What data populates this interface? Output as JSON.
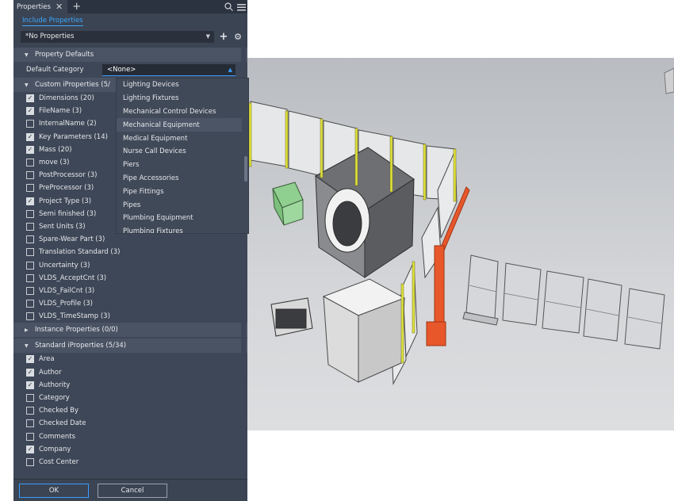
{
  "panel": {
    "tab_label": "Properties",
    "include_link": "Include Properties",
    "preset_value": "*No Properties"
  },
  "property_defaults": {
    "header": "Property Defaults",
    "default_category_label": "Default Category",
    "default_category_value": "<None>"
  },
  "dropdown_options": [
    "Lighting Devices",
    "Lighting Fixtures",
    "Mechanical Control Devices",
    "Mechanical Equipment",
    "Medical Equipment",
    "Nurse Call Devices",
    "Piers",
    "Pipe Accessories",
    "Pipe Fittings",
    "Pipes",
    "Plumbing Equipment",
    "Plumbing Fixtures"
  ],
  "custom": {
    "header": "Custom iProperties (5/",
    "items": [
      {
        "label": "Dimensions (20)",
        "checked": true
      },
      {
        "label": "FileName (3)",
        "checked": true
      },
      {
        "label": "InternalName (2)",
        "checked": false
      },
      {
        "label": "Key Parameters (14)",
        "checked": true
      },
      {
        "label": "Mass (20)",
        "checked": true
      },
      {
        "label": "move (3)",
        "checked": false
      },
      {
        "label": "PostProcessor (3)",
        "checked": false
      },
      {
        "label": "PreProcessor (3)",
        "checked": false
      },
      {
        "label": "Project Type (3)",
        "checked": true
      },
      {
        "label": "Semi finished (3)",
        "checked": false
      },
      {
        "label": "Sent Units (3)",
        "checked": false
      },
      {
        "label": "Spare-Wear Part (3)",
        "checked": false
      },
      {
        "label": "Translation Standard (3)",
        "checked": false
      },
      {
        "label": "Uncertainty (3)",
        "checked": false
      },
      {
        "label": "VLDS_AcceptCnt (3)",
        "checked": false
      },
      {
        "label": "VLDS_FailCnt (3)",
        "checked": false
      },
      {
        "label": "VLDS_Profile (3)",
        "checked": false
      },
      {
        "label": "VLDS_TimeStamp (3)",
        "checked": false
      }
    ]
  },
  "instance": {
    "header": "Instance Properties (0/0)"
  },
  "standard": {
    "header": "Standard iProperties (5/34)",
    "items": [
      {
        "label": "Area",
        "checked": true
      },
      {
        "label": "Author",
        "checked": true
      },
      {
        "label": "Authority",
        "checked": true
      },
      {
        "label": "Category",
        "checked": false
      },
      {
        "label": "Checked By",
        "checked": false
      },
      {
        "label": "Checked Date",
        "checked": false
      },
      {
        "label": "Comments",
        "checked": false
      },
      {
        "label": "Company",
        "checked": true
      },
      {
        "label": "Cost Center",
        "checked": false
      }
    ]
  },
  "footer": {
    "ok_label": "OK",
    "cancel_label": "Cancel"
  }
}
